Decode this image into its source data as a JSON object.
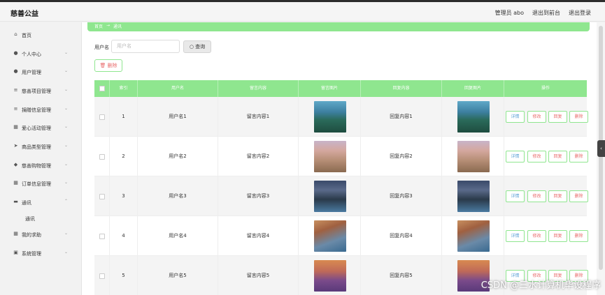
{
  "header": {
    "brand": "慈善公益",
    "admin": "管理员 abo",
    "to_front": "退出到前台",
    "logout": "退出登录"
  },
  "sidebar": {
    "items": [
      {
        "label": "首页",
        "icon": "home-icon"
      },
      {
        "label": "个人中心",
        "icon": "user-icon"
      },
      {
        "label": "用户管理",
        "icon": "user-icon"
      },
      {
        "label": "慈善项目管理",
        "icon": "list-icon"
      },
      {
        "label": "捐赠信息管理",
        "icon": "list-icon"
      },
      {
        "label": "爱心活动管理",
        "icon": "grid-icon"
      },
      {
        "label": "商品类型管理",
        "icon": "paper-plane-icon"
      },
      {
        "label": "慈善购物管理",
        "icon": "shield-icon"
      },
      {
        "label": "订单信息管理",
        "icon": "grid-icon"
      },
      {
        "label": "通讯",
        "icon": "chat-icon"
      },
      {
        "label": "我的求助",
        "icon": "grid-icon"
      },
      {
        "label": "系统管理",
        "icon": "lock-icon"
      }
    ],
    "subitem": "通讯"
  },
  "breadcrumb": {
    "home": "首页",
    "arrow": "→",
    "current": "通讯"
  },
  "search": {
    "label": "用户名",
    "placeholder": "用户名",
    "button": "查询"
  },
  "toolbar": {
    "delete": "删除"
  },
  "table": {
    "headers": [
      "索引",
      "用户名",
      "留言内容",
      "留言图片",
      "回复内容",
      "回复图片",
      "操作"
    ],
    "rows": [
      {
        "index": "1",
        "username": "用户名1",
        "message": "留言内容1",
        "reply": "回复内容1"
      },
      {
        "index": "2",
        "username": "用户名2",
        "message": "留言内容2",
        "reply": "回复内容2"
      },
      {
        "index": "3",
        "username": "用户名3",
        "message": "留言内容3",
        "reply": "回复内容3"
      },
      {
        "index": "4",
        "username": "用户名4",
        "message": "留言内容4",
        "reply": "回复内容4"
      },
      {
        "index": "5",
        "username": "用户名5",
        "message": "留言内容5",
        "reply": "回复内容5"
      }
    ],
    "actions": {
      "detail": "详情",
      "edit": "修改",
      "reply": "回复",
      "delete": "删除"
    }
  },
  "watermark": "CSDN @三水计算机毕设程序"
}
